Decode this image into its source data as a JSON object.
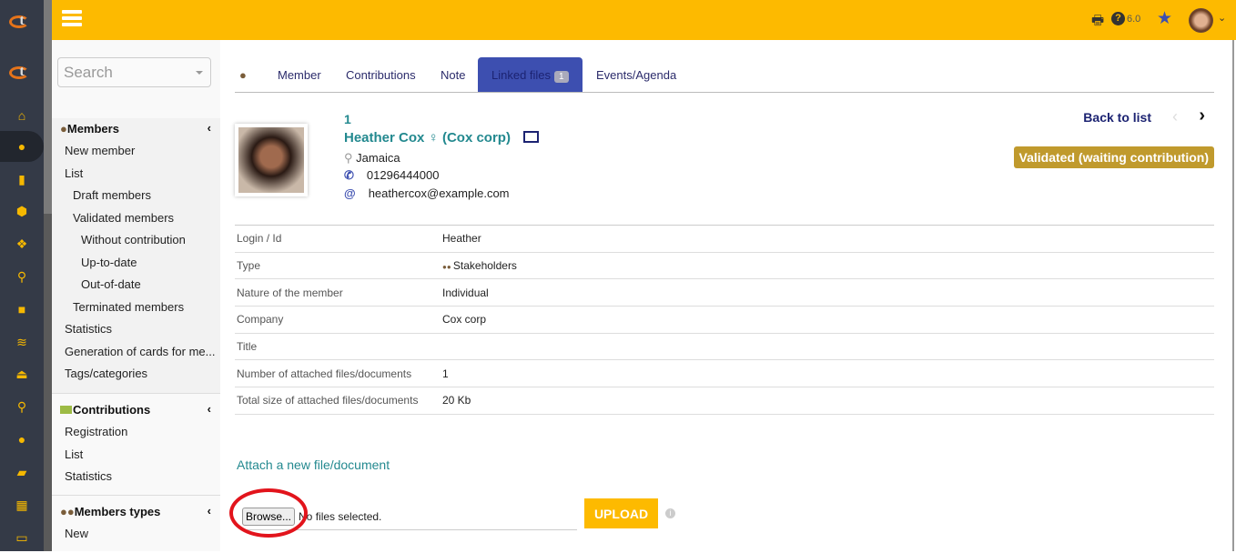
{
  "header": {
    "version": "6.0",
    "icons": [
      "menu-icon",
      "print-icon",
      "help-icon",
      "star-icon",
      "user-avatar",
      "chevron-down-icon"
    ]
  },
  "nav_icons": [
    "home",
    "user",
    "building",
    "box",
    "cubes",
    "sitemap",
    "briefcase",
    "coins",
    "bank",
    "search-dollar",
    "user-tie",
    "folder-open",
    "calendar",
    "ticket"
  ],
  "search": {
    "placeholder": "Search"
  },
  "menu": {
    "members": {
      "title": "Members",
      "items": [
        {
          "label": "New member",
          "level": 0
        },
        {
          "label": "List",
          "level": 0
        },
        {
          "label": "Draft members",
          "level": 1
        },
        {
          "label": "Validated members",
          "level": 1
        },
        {
          "label": "Without contribution",
          "level": 2
        },
        {
          "label": "Up-to-date",
          "level": 2
        },
        {
          "label": "Out-of-date",
          "level": 2
        },
        {
          "label": "Terminated members",
          "level": 1
        },
        {
          "label": "Statistics",
          "level": 0
        },
        {
          "label": "Generation of cards for me...",
          "level": 0
        },
        {
          "label": "Tags/categories",
          "level": 0
        }
      ]
    },
    "contributions": {
      "title": "Contributions",
      "items": [
        {
          "label": "Registration"
        },
        {
          "label": "List"
        },
        {
          "label": "Statistics"
        }
      ]
    },
    "member_types": {
      "title": "Members types",
      "items": [
        {
          "label": "New"
        }
      ]
    }
  },
  "tabs": [
    {
      "label": "Member"
    },
    {
      "label": "Contributions"
    },
    {
      "label": "Note"
    },
    {
      "label": "Linked files",
      "badge": "1",
      "active": true
    },
    {
      "label": "Events/Agenda"
    }
  ],
  "member": {
    "id": "1",
    "name": "Heather Cox",
    "gender_symbol": "♀",
    "company": "(Cox corp)",
    "country": "Jamaica",
    "phone": "01296444000",
    "email": "heathercox@example.com",
    "back": "Back to list",
    "status": "Validated (waiting contribution)"
  },
  "fields": [
    {
      "label": "Login / Id",
      "value": "Heather"
    },
    {
      "label": "Type",
      "value": "Stakeholders"
    },
    {
      "label": "Nature of the member",
      "value": "Individual"
    },
    {
      "label": "Company",
      "value": "Cox corp"
    },
    {
      "label": "Title",
      "value": ""
    },
    {
      "label": "Number of attached files/documents",
      "value": "1"
    },
    {
      "label": "Total size of attached files/documents",
      "value": "20 Kb"
    }
  ],
  "upload": {
    "title": "Attach a new file/document",
    "browse": "Browse...",
    "no_file": "No files selected.",
    "button": "UPLOAD"
  },
  "colors": {
    "header": "#fdba00",
    "active_tab": "#3d4fb0",
    "status": "#c09a2d",
    "teal": "#23898f",
    "annotation": "#e2141c"
  }
}
